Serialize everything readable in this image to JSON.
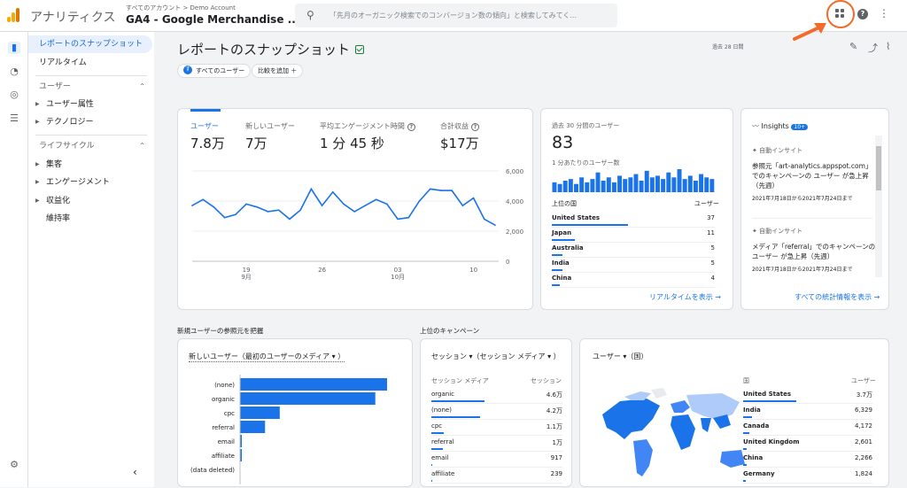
{
  "topbar": {
    "app_title": "アナリティクス",
    "breadcrumb": "すべてのアカウント > Demo Account",
    "property": "GA4 - Google Merchandise ...",
    "search_placeholder": "「先月のオーガニック検索でのコンバージョン数の傾向」と検索してみてく..."
  },
  "nav": {
    "snapshot": "レポートのスナップショット",
    "realtime": "リアルタイム",
    "user_section": "ユーザー",
    "user_attr": "ユーザー属性",
    "tech": "テクノロジー",
    "lifecycle": "ライフサイクル",
    "acquisition": "集客",
    "engagement": "エンゲージメント",
    "monetization": "収益化",
    "retention": "維持率"
  },
  "header": {
    "title": "レポートのスナップショット",
    "period": "過去 28 日間",
    "chip_all_users": "すべてのユーザー",
    "chip_avatar": "す",
    "chip_add_compare": "比較を追加 ＋"
  },
  "metrics": [
    {
      "label": "ユーザー",
      "value": "7.8万"
    },
    {
      "label": "新しいユーザー",
      "value": "7万"
    },
    {
      "label": "平均エンゲージメント時間",
      "value": "1 分 45 秒"
    },
    {
      "label": "合計収益",
      "value": "$17万"
    }
  ],
  "chart_data": {
    "type": "line",
    "x": [
      14,
      15,
      16,
      17,
      18,
      19,
      20,
      21,
      22,
      23,
      24,
      25,
      26,
      27,
      28,
      29,
      30,
      1,
      2,
      3,
      4,
      5,
      6,
      7,
      8,
      9,
      10,
      11,
      12
    ],
    "x_ticks": [
      {
        "label": "19",
        "sub": "9月"
      },
      {
        "label": "26",
        "sub": ""
      },
      {
        "label": "03",
        "sub": "10月"
      },
      {
        "label": "10",
        "sub": ""
      }
    ],
    "values": [
      3700,
      4100,
      3600,
      2900,
      3100,
      3800,
      3600,
      3300,
      3400,
      2800,
      3400,
      4800,
      3700,
      4600,
      3800,
      3300,
      3700,
      4100,
      3800,
      2800,
      2900,
      4000,
      4800,
      4700,
      4700,
      3700,
      4200,
      2800,
      2400
    ],
    "y_ticks": [
      "6,000",
      "4,000",
      "2,000",
      "0"
    ],
    "ylim": [
      0,
      6000
    ]
  },
  "realtime": {
    "title": "過去 30 分間のユーザー",
    "count": "83",
    "per_min": "1 分あたりのユーザー数",
    "bars": [
      6,
      5,
      7,
      8,
      5,
      9,
      6,
      8,
      12,
      7,
      9,
      6,
      10,
      8,
      9,
      11,
      7,
      13,
      9,
      10,
      8,
      12,
      9,
      14,
      8,
      10,
      7,
      11,
      9,
      8
    ],
    "col_country": "上位の国",
    "col_users": "ユーザー",
    "rows": [
      {
        "country": "United States",
        "users": "37",
        "share": 1.0
      },
      {
        "country": "Japan",
        "users": "11",
        "share": 0.3
      },
      {
        "country": "Australia",
        "users": "5",
        "share": 0.14
      },
      {
        "country": "India",
        "users": "5",
        "share": 0.14
      },
      {
        "country": "China",
        "users": "4",
        "share": 0.11
      }
    ],
    "link": "リアルタイムを表示 →"
  },
  "insights": {
    "title": "Insights",
    "badge": "10+",
    "items": [
      {
        "tag": "自動インサイト",
        "text": "参照元「art-analytics.appspot.com」でのキャンペーンの ユーザー が急上昇（先週）",
        "date": "2021年7月18日から2021年7月24日まで"
      },
      {
        "tag": "自動インサイト",
        "text": "メディア「referral」でのキャンペーンの ユーザー が急上昇（先週）",
        "date": "2021年7月18日から2021年7月24日まで"
      }
    ],
    "link": "すべての統計情報を表示 →"
  },
  "referrals": {
    "section": "新規ユーザーの参照元を把握",
    "dropdown": "新しいユーザー（最初のユーザーのメディア ▾ ）",
    "rows": [
      {
        "label": "(none)",
        "value": 1.0
      },
      {
        "label": "organic",
        "value": 0.92
      },
      {
        "label": "cpc",
        "value": 0.27
      },
      {
        "label": "referral",
        "value": 0.17
      },
      {
        "label": "email",
        "value": 0.01
      },
      {
        "label": "affiliate",
        "value": 0.01
      },
      {
        "label": "(data deleted)",
        "value": 0.0
      }
    ]
  },
  "campaigns": {
    "section": "上位のキャンペーン",
    "dropdown": "セッション ▾（セッション メディア ▾ ）",
    "col1": "セッション メディア",
    "col2": "セッション",
    "rows": [
      {
        "name": "organic",
        "value": "4.6万",
        "share": 1.0
      },
      {
        "name": "(none)",
        "value": "4.2万",
        "share": 0.91
      },
      {
        "name": "cpc",
        "value": "1.1万",
        "share": 0.24
      },
      {
        "name": "referral",
        "value": "1万",
        "share": 0.22
      },
      {
        "name": "email",
        "value": "917",
        "share": 0.02
      },
      {
        "name": "affiliate",
        "value": "239",
        "share": 0.01
      }
    ]
  },
  "countries": {
    "dropdown": "ユーザー ▾（国）",
    "col1": "国",
    "col2": "ユーザー",
    "rows": [
      {
        "name": "United States",
        "value": "3.7万",
        "share": 1.0
      },
      {
        "name": "India",
        "value": "6,329",
        "share": 0.17
      },
      {
        "name": "Canada",
        "value": "4,172",
        "share": 0.11
      },
      {
        "name": "United Kingdom",
        "value": "2,601",
        "share": 0.07
      },
      {
        "name": "China",
        "value": "2,266",
        "share": 0.06
      },
      {
        "name": "Germany",
        "value": "1,824",
        "share": 0.05
      }
    ]
  },
  "colors": {
    "accent": "#1a73e8",
    "callout": "#f26b2a"
  }
}
